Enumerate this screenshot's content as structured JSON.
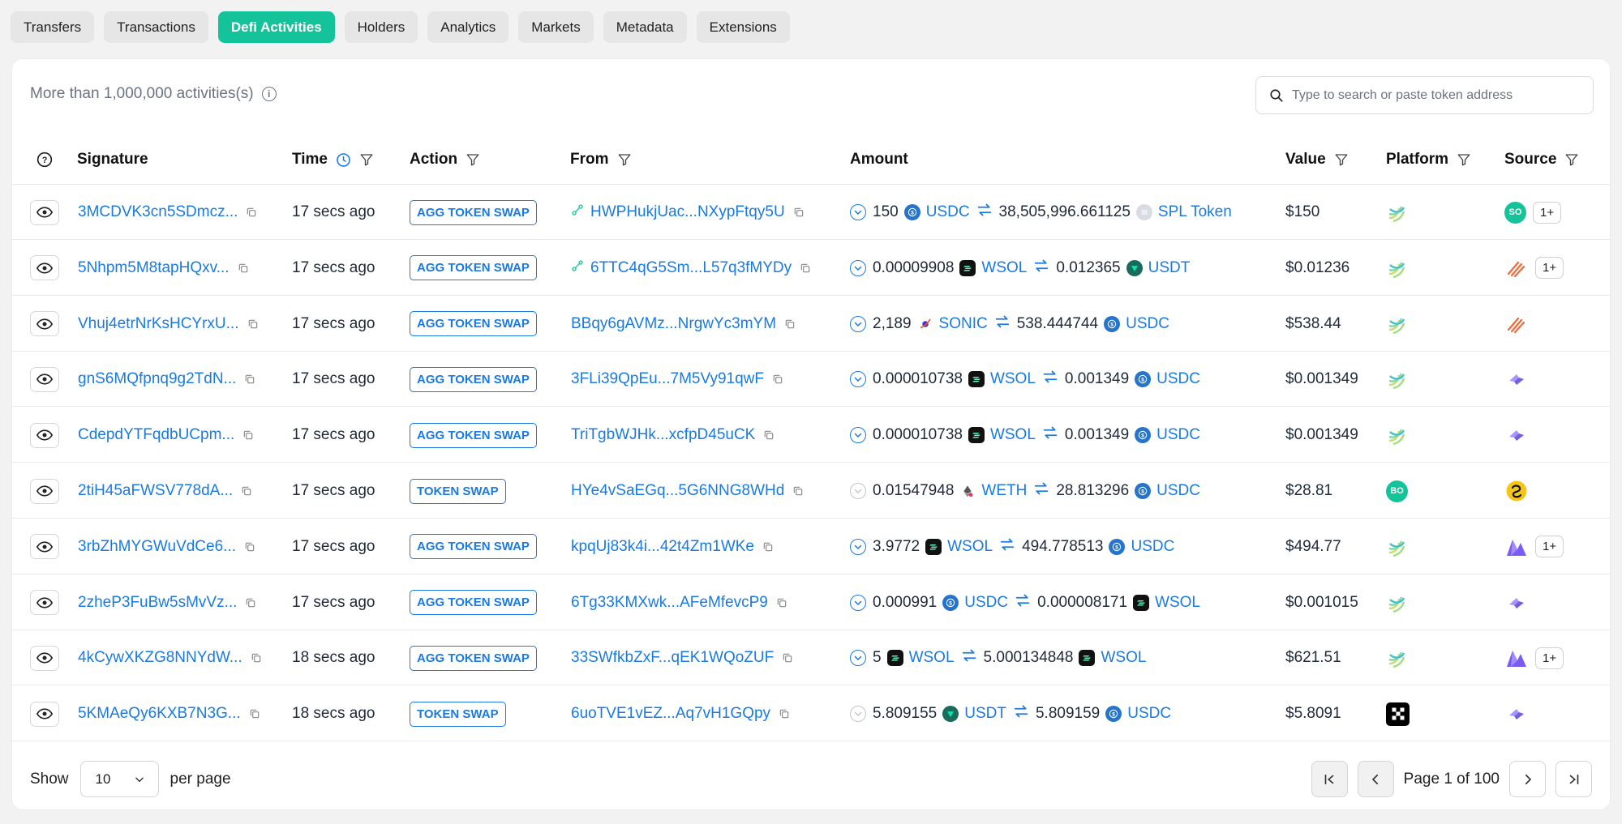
{
  "tabs": [
    {
      "label": "Transfers",
      "active": false
    },
    {
      "label": "Transactions",
      "active": false
    },
    {
      "label": "Defi Activities",
      "active": true
    },
    {
      "label": "Holders",
      "active": false
    },
    {
      "label": "Analytics",
      "active": false
    },
    {
      "label": "Markets",
      "active": false
    },
    {
      "label": "Metadata",
      "active": false
    },
    {
      "label": "Extensions",
      "active": false
    }
  ],
  "summary": "More than 1,000,000 activities(s)",
  "search": {
    "placeholder": "Type to search or paste token address"
  },
  "columns": {
    "signature": "Signature",
    "time": "Time",
    "action": "Action",
    "from": "From",
    "amount": "Amount",
    "value": "Value",
    "platform": "Platform",
    "source": "Source"
  },
  "rows": [
    {
      "signature": "3MCDVK3cn5SDmcz...",
      "time": "17 secs ago",
      "action": "AGG TOKEN SWAP",
      "from": "HWPHukjUac...NXypFtqy5U",
      "from_icon": true,
      "in_amount": "150",
      "in_token": "USDC",
      "out_amount": "38,505,996.661125",
      "out_token": "SPL Token",
      "value": "$150",
      "platform": "aggregator",
      "source": [
        "so-badge"
      ],
      "source_more": "1+"
    },
    {
      "signature": "5Nhpm5M8tapHQxv...",
      "time": "17 secs ago",
      "action": "AGG TOKEN SWAP",
      "from": "6TTC4qG5Sm...L57q3fMYDy",
      "from_icon": true,
      "in_amount": "0.00009908",
      "in_token": "WSOL",
      "out_amount": "0.012365",
      "out_token": "USDT",
      "value": "$0.01236",
      "platform": "aggregator",
      "source": [
        "stripes"
      ],
      "source_more": "1+"
    },
    {
      "signature": "Vhuj4etrNrKsHCYrxU...",
      "time": "17 secs ago",
      "action": "AGG TOKEN SWAP",
      "from": "BBqy6gAVMz...NrgwYc3mYM",
      "from_icon": false,
      "in_amount": "2,189",
      "in_token": "SONIC",
      "out_amount": "538.444744",
      "out_token": "USDC",
      "value": "$538.44",
      "platform": "aggregator",
      "source": [
        "stripes"
      ],
      "source_more": ""
    },
    {
      "signature": "gnS6MQfpnq9g2TdN...",
      "time": "17 secs ago",
      "action": "AGG TOKEN SWAP",
      "from": "3FLi39QpEu...7M5Vy91qwF",
      "from_icon": false,
      "in_amount": "0.000010738",
      "in_token": "WSOL",
      "out_amount": "0.001349",
      "out_token": "USDC",
      "value": "$0.001349",
      "platform": "aggregator",
      "source": [
        "arrow"
      ],
      "source_more": ""
    },
    {
      "signature": "CdepdYTFqdbUCpm...",
      "time": "17 secs ago",
      "action": "AGG TOKEN SWAP",
      "from": "TriTgbWJHk...xcfpD45uCK",
      "from_icon": false,
      "in_amount": "0.000010738",
      "in_token": "WSOL",
      "out_amount": "0.001349",
      "out_token": "USDC",
      "value": "$0.001349",
      "platform": "aggregator",
      "source": [
        "arrow"
      ],
      "source_more": ""
    },
    {
      "signature": "2tiH45aFWSV778dA...",
      "time": "17 secs ago",
      "action": "TOKEN SWAP",
      "from": "HYe4vSaEGq...5G6NNG8WHd",
      "from_icon": false,
      "in_amount": "0.01547948",
      "in_token": "WETH",
      "out_amount": "28.813296",
      "out_token": "USDC",
      "value": "$28.81",
      "platform": "bo-badge",
      "source": [
        "snake"
      ],
      "source_more": ""
    },
    {
      "signature": "3rbZhMYGWuVdCe6...",
      "time": "17 secs ago",
      "action": "AGG TOKEN SWAP",
      "from": "kpqUj83k4i...42t4Zm1WKe",
      "from_icon": false,
      "in_amount": "3.9772",
      "in_token": "WSOL",
      "out_amount": "494.778513",
      "out_token": "USDC",
      "value": "$494.77",
      "platform": "aggregator",
      "source": [
        "mountain"
      ],
      "source_more": "1+"
    },
    {
      "signature": "2zheP3FuBw5sMvVz...",
      "time": "17 secs ago",
      "action": "AGG TOKEN SWAP",
      "from": "6Tg33KMXwk...AFeMfevcP9",
      "from_icon": false,
      "in_amount": "0.000991",
      "in_token": "USDC",
      "out_amount": "0.000008171",
      "out_token": "WSOL",
      "value": "$0.001015",
      "platform": "aggregator",
      "source": [
        "arrow"
      ],
      "source_more": ""
    },
    {
      "signature": "4kCywXKZG8NNYdW...",
      "time": "18 secs ago",
      "action": "AGG TOKEN SWAP",
      "from": "33SWfkbZxF...qEK1WQoZUF",
      "from_icon": false,
      "in_amount": "5",
      "in_token": "WSOL",
      "out_amount": "5.000134848",
      "out_token": "WSOL",
      "value": "$621.51",
      "platform": "aggregator",
      "source": [
        "mountain"
      ],
      "source_more": "1+"
    },
    {
      "signature": "5KMAeQy6KXB7N3G...",
      "time": "18 secs ago",
      "action": "TOKEN SWAP",
      "from": "6uoTVE1vEZ...Aq7vH1GQpy",
      "from_icon": false,
      "in_amount": "5.809155",
      "in_token": "USDT",
      "out_amount": "5.809159",
      "out_token": "USDC",
      "value": "$5.8091",
      "platform": "okx",
      "source": [
        "arrow"
      ],
      "source_more": ""
    }
  ],
  "footer": {
    "show_label": "Show",
    "per_page_value": "10",
    "per_page_label": "per page",
    "page_text": "Page 1 of 100"
  },
  "colors": {
    "accent": "#14c39a",
    "link": "#1a7ae0"
  }
}
